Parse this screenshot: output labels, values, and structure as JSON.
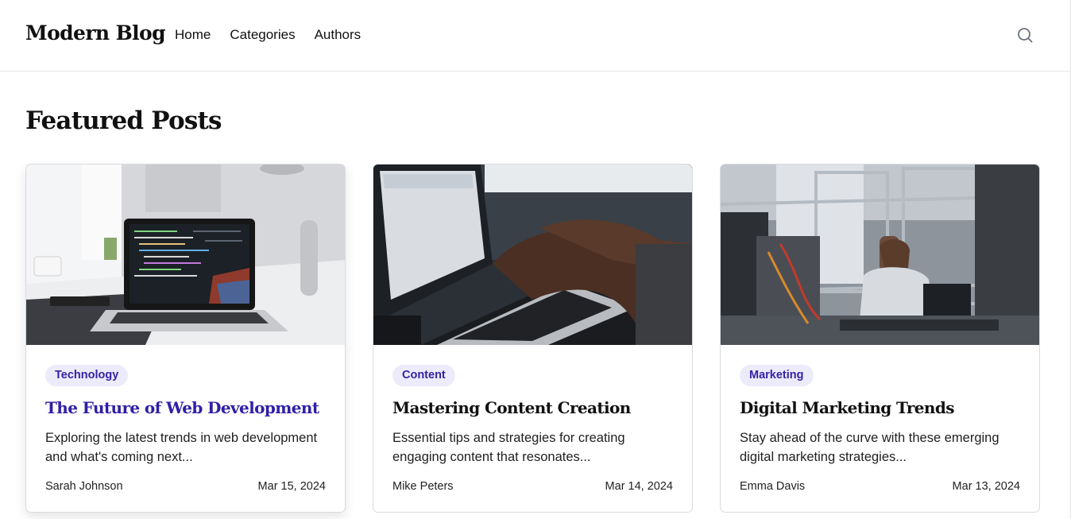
{
  "header": {
    "logo": "Modern Blog",
    "nav": [
      "Home",
      "Categories",
      "Authors"
    ],
    "search_icon": "search-icon"
  },
  "main": {
    "section_title": "Featured Posts",
    "posts": [
      {
        "category": "Technology",
        "title": "The Future of Web Development",
        "excerpt": "Exploring the latest trends in web development and what's coming next...",
        "author": "Sarah Johnson",
        "date": "Mar 15, 2024"
      },
      {
        "category": "Content",
        "title": "Mastering Content Creation",
        "excerpt": "Essential tips and strategies for creating engaging content that resonates...",
        "author": "Mike Peters",
        "date": "Mar 14, 2024"
      },
      {
        "category": "Marketing",
        "title": "Digital Marketing Trends",
        "excerpt": "Stay ahead of the curve with these emerging digital marketing strategies...",
        "author": "Emma Davis",
        "date": "Mar 13, 2024"
      }
    ]
  },
  "colors": {
    "accent": "#2f1fa6",
    "badge_bg": "#ecebfb",
    "badge_text": "#3422a6",
    "border": "#d9dbe0"
  }
}
